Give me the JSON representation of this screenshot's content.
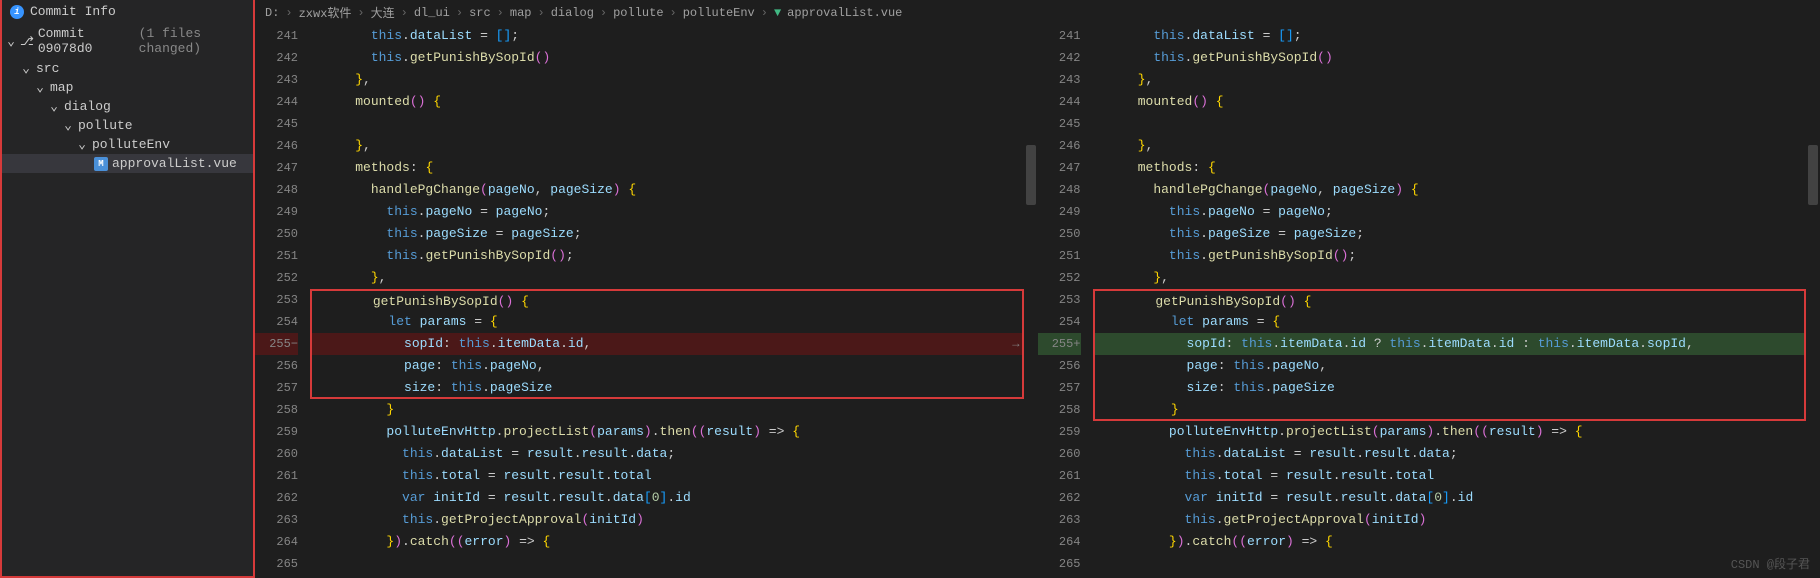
{
  "sidebar": {
    "title": "Commit Info",
    "commit_label": "Commit 09078d0",
    "files_changed": "(1 files changed)",
    "tree": {
      "src": "src",
      "map": "map",
      "dialog": "dialog",
      "pollute": "pollute",
      "polluteEnv": "polluteEnv",
      "file": "approvalList.vue"
    }
  },
  "breadcrumb": {
    "drive": "D:",
    "p1": "zxwx软件",
    "p2": "大连",
    "p3": "dl_ui",
    "p4": "src",
    "p5": "map",
    "p6": "dialog",
    "p7": "pollute",
    "p8": "polluteEnv",
    "file": "approvalList.vue"
  },
  "line_numbers": [
    "241",
    "242",
    "243",
    "244",
    "245",
    "246",
    "247",
    "248",
    "249",
    "250",
    "251",
    "252",
    "253",
    "254",
    "255",
    "256",
    "257",
    "258",
    "259",
    "260",
    "261",
    "262",
    "263",
    "264",
    "265"
  ],
  "watermark": "CSDN @段子君",
  "chart_data": {
    "type": "table",
    "title": "Code diff — approvalList.vue (left=old, right=new)",
    "left_lines": [
      {
        "n": 241,
        "t": "      this.dataList = [];"
      },
      {
        "n": 242,
        "t": "      this.getPunishBySopId()"
      },
      {
        "n": 243,
        "t": "    },"
      },
      {
        "n": 244,
        "t": "    mounted() {"
      },
      {
        "n": 245,
        "t": ""
      },
      {
        "n": 246,
        "t": "    },"
      },
      {
        "n": 247,
        "t": "    methods: {"
      },
      {
        "n": 248,
        "t": "      handlePgChange(pageNo, pageSize) {"
      },
      {
        "n": 249,
        "t": "        this.pageNo = pageNo;"
      },
      {
        "n": 250,
        "t": "        this.pageSize = pageSize;"
      },
      {
        "n": 251,
        "t": "        this.getPunishBySopId();"
      },
      {
        "n": 252,
        "t": "      },"
      },
      {
        "n": 253,
        "t": "      getPunishBySopId() {"
      },
      {
        "n": 254,
        "t": "        let params = {"
      },
      {
        "n": 255,
        "t": "          sopId: this.itemData.id,",
        "mark": "removed"
      },
      {
        "n": 256,
        "t": "          page: this.pageNo,"
      },
      {
        "n": 257,
        "t": "          size: this.pageSize"
      },
      {
        "n": 258,
        "t": "        }"
      },
      {
        "n": 259,
        "t": "        polluteEnvHttp.projectList(params).then((result) => {"
      },
      {
        "n": 260,
        "t": "          this.dataList = result.result.data;"
      },
      {
        "n": 261,
        "t": "          this.total = result.result.total"
      },
      {
        "n": 262,
        "t": "          var initId = result.result.data[0].id"
      },
      {
        "n": 263,
        "t": "          this.getProjectApproval(initId)"
      },
      {
        "n": 264,
        "t": "        }).catch((error) => {"
      },
      {
        "n": 265,
        "t": ""
      }
    ],
    "right_lines": [
      {
        "n": 241,
        "t": "      this.dataList = [];"
      },
      {
        "n": 242,
        "t": "      this.getPunishBySopId()"
      },
      {
        "n": 243,
        "t": "    },"
      },
      {
        "n": 244,
        "t": "    mounted() {"
      },
      {
        "n": 245,
        "t": ""
      },
      {
        "n": 246,
        "t": "    },"
      },
      {
        "n": 247,
        "t": "    methods: {"
      },
      {
        "n": 248,
        "t": "      handlePgChange(pageNo, pageSize) {"
      },
      {
        "n": 249,
        "t": "        this.pageNo = pageNo;"
      },
      {
        "n": 250,
        "t": "        this.pageSize = pageSize;"
      },
      {
        "n": 251,
        "t": "        this.getPunishBySopId();"
      },
      {
        "n": 252,
        "t": "      },"
      },
      {
        "n": 253,
        "t": "      getPunishBySopId() {"
      },
      {
        "n": 254,
        "t": "        let params = {"
      },
      {
        "n": 255,
        "t": "          sopId: this.itemData.id ? this.itemData.id : this.itemData.sopId,",
        "mark": "added"
      },
      {
        "n": 256,
        "t": "          page: this.pageNo,"
      },
      {
        "n": 257,
        "t": "          size: this.pageSize"
      },
      {
        "n": 258,
        "t": "        }"
      },
      {
        "n": 259,
        "t": "        polluteEnvHttp.projectList(params).then((result) => {"
      },
      {
        "n": 260,
        "t": "          this.dataList = result.result.data;"
      },
      {
        "n": 261,
        "t": "          this.total = result.result.total"
      },
      {
        "n": 262,
        "t": "          var initId = result.result.data[0].id"
      },
      {
        "n": 263,
        "t": "          this.getProjectApproval(initId)"
      },
      {
        "n": 264,
        "t": "        }).catch((error) => {"
      },
      {
        "n": 265,
        "t": ""
      }
    ]
  }
}
